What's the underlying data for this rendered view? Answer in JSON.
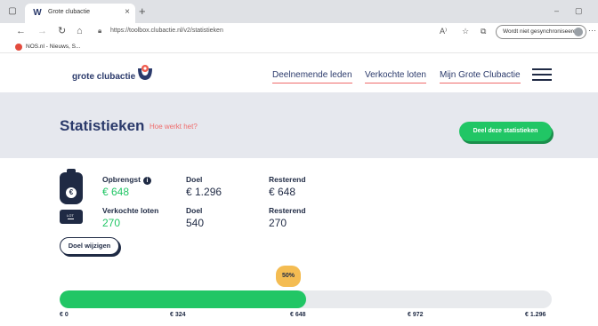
{
  "browser": {
    "tab": {
      "title": "Grote clubactie"
    },
    "url": "https://toolbox.clubactie.nl/v2/statistieken",
    "sync_label": "Wordt niet gesynchroniseerd",
    "bookmark": {
      "label": "NOS.nl - Nieuws, S..."
    }
  },
  "site": {
    "logo_text": "grote clubactie",
    "nav": [
      "Deelnemende leden",
      "Verkochte loten",
      "Mijn Grote Clubactie"
    ]
  },
  "banner": {
    "title": "Statistieken",
    "help_link": "Hoe werkt het?",
    "share_button": "Deel deze statistieken"
  },
  "stats": {
    "revenue": {
      "label": "Opbrengst",
      "value": "€ 648",
      "goal_label": "Doel",
      "goal_value": "€ 1.296",
      "remaining_label": "Resterend",
      "remaining_value": "€ 648"
    },
    "tickets": {
      "label": "Verkochte loten",
      "value": "270",
      "goal_label": "Doel",
      "goal_value": "540",
      "remaining_label": "Resterend",
      "remaining_value": "270"
    },
    "ticket_icon_text": "LOT"
  },
  "goal_button": "Doel wijzigen",
  "progress": {
    "percent_label": "50%",
    "fraction": 0.5,
    "ticks": [
      "€ 0",
      "€ 324",
      "€ 648",
      "€ 972",
      "€ 1.296"
    ]
  },
  "colors": {
    "accent_green": "#21c665",
    "navy": "#1f2a44",
    "coral": "#ef6b6b",
    "badge_yellow": "#f4bc52",
    "banner_bg": "#e6e8ee"
  }
}
